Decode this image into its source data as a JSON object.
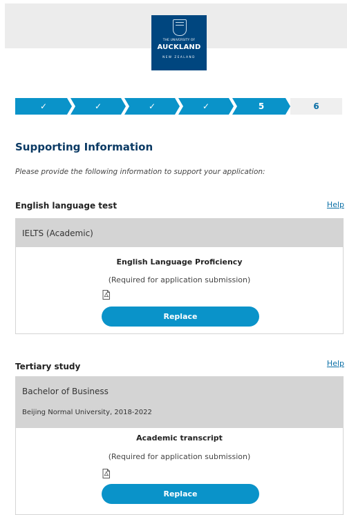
{
  "header": {
    "logo": {
      "line1": "THE UNIVERSITY OF",
      "line2": "AUCKLAND",
      "line3": "NEW ZEALAND"
    }
  },
  "progress": {
    "steps": [
      {
        "label": "✓",
        "state": "complete"
      },
      {
        "label": "✓",
        "state": "complete"
      },
      {
        "label": "✓",
        "state": "complete"
      },
      {
        "label": "✓",
        "state": "complete"
      },
      {
        "label": "5",
        "state": "current"
      },
      {
        "label": "6",
        "state": "upcoming"
      }
    ]
  },
  "page": {
    "title": "Supporting Information",
    "intro": "Please provide the following information to support your application:"
  },
  "sections": [
    {
      "title": "English language test",
      "help": "Help",
      "lines": [
        "IELTS (Academic)"
      ],
      "document": {
        "title": "English Language Proficiency",
        "note": "(Required for application submission)",
        "icon": "pdf-icon",
        "button": "Replace"
      }
    },
    {
      "title": "Tertiary study",
      "help": "Help",
      "lines": [
        "Bachelor of Business",
        "Beijing Normal University, 2018-2022"
      ],
      "document": {
        "title": "Academic transcript",
        "note": "(Required for application submission)",
        "icon": "pdf-icon",
        "button": "Replace"
      }
    }
  ],
  "colors": {
    "accent": "#0a93c9",
    "heading": "#0b3a64",
    "logo_bg": "#00467f",
    "grey_panel": "#d4d4d4",
    "header_bg": "#ececec"
  }
}
